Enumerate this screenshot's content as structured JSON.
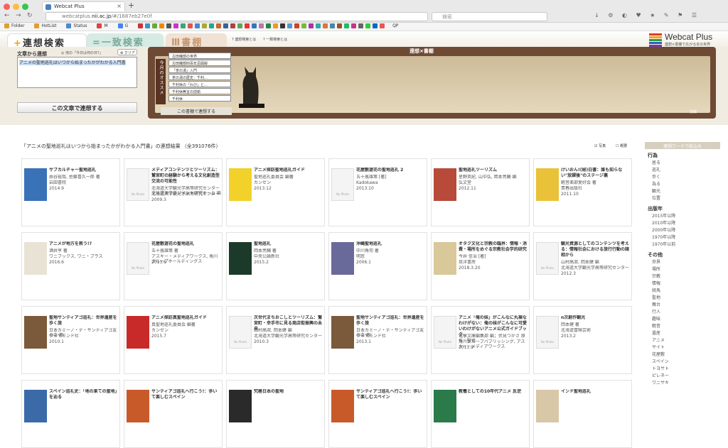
{
  "browser": {
    "tab_title": "Webcat Plus",
    "url_prefix": "webcatplus.",
    "url_domain": "nii.ac.jp",
    "url_suffix": "/#/1687eb27e0f",
    "search_placeholder": "検索"
  },
  "bookmarks": [
    "Folder",
    "HotList",
    "Status",
    "M",
    "G",
    "QP"
  ],
  "tabs": {
    "assoc": "連想検索",
    "exact": "一致検索",
    "shelf": "書棚"
  },
  "help": {
    "assoc": "連想検索とは",
    "exact": "一致検索とは"
  },
  "logo": {
    "title": "Webcat Plus",
    "sub": "連想×書棚で広がる本の世界",
    "colors": [
      "#e23a2a",
      "#f3a51c",
      "#2a9a4b",
      "#2a64b2",
      "#7a3aa0"
    ]
  },
  "query": {
    "label": "文章から連想",
    "sub": "他の「今日は何の日?」",
    "clear": "クリア",
    "text": "アニメの聖地巡礼はいつから始まったかがわかる入門書",
    "button": "この文章で連想する"
  },
  "shelf": {
    "title": "連想×書棚",
    "vertical": "今月のオススメ",
    "books": [
      "古田織部の世界",
      "古田織部四百年忌図録",
      "「茶の湯」入門",
      "茶の湯の歴史：千利…",
      "千利休の「わび」と…",
      "千利休無言の前衛",
      "千利休"
    ],
    "button": "この書棚で連想する",
    "bottom": "前編"
  },
  "results": {
    "summary": "「アニメの聖地巡礼はいつから始まったかがわかる入門書」の連想結果 （全391076件）",
    "photo": "写真",
    "abstract": "概要"
  },
  "nophoto": "No Photo",
  "cards": [
    {
      "title": "サブカルチャー聖地巡礼",
      "meta": [
        "由谷裕哉, 佐藤喜久一郎 著",
        "岩田書院",
        "2014.9"
      ],
      "thumb": "#3a72b8"
    },
    {
      "title": "メディアコンテンツとツーリズム：鷲宮町の経験から考える文化創造型交流の可能性",
      "meta": [
        "北海道大学観光学高等研究センター文化資源マネジメント研究チーム 編",
        "北海道大学観光学高等研究センター",
        "2009.3"
      ],
      "thumb": ""
    },
    {
      "title": "アニメ探訪聖地巡礼ガイド",
      "meta": [
        "聖地巡礼委員会 編著",
        "カンゼン",
        "2013.12"
      ],
      "thumb": "#f2d12a"
    },
    {
      "title": "花屋敷遊花の聖地巡礼 2",
      "meta": [
        "五十嵐雄策 [著]",
        "Kadokawa",
        "2013.10"
      ],
      "thumb": ""
    },
    {
      "title": "聖地巡礼ツーリズム",
      "meta": [
        "星野英紀, 山中弘, 岡本亮輔 編",
        "弘文堂",
        "2012.11"
      ],
      "thumb": "#b84a3a"
    },
    {
      "title": "けいおん!(秘)白書：誰も知らない\"放課後\"のステージ裏",
      "meta": [
        "軽音楽部愛好会 著",
        "青春出版社",
        "2011.10"
      ],
      "thumb": "#e9c23a"
    },
    {
      "title": "アニメが地方を救う!?",
      "meta": [
        "酒井亨 著",
        "ワニブックス, ワニ・プラス",
        "2016.6"
      ],
      "thumb": "#e8e3d4"
    },
    {
      "title": "花屋敷遊花の聖地巡礼",
      "meta": [
        "五十嵐雄策 著",
        "アスキー・メディアワークス, 角川グループホールディングス",
        "2013.6"
      ],
      "thumb": ""
    },
    {
      "title": "聖地巡礼",
      "meta": [
        "岡本亮輔 著",
        "中央公論新社",
        "2015.2"
      ],
      "thumb": "#1c3a2a"
    },
    {
      "title": "沖縄聖地巡礼",
      "meta": [
        "中川角司 著",
        "明窓",
        "2006.1"
      ],
      "thumb": "#6a6a9a"
    },
    {
      "title": "オタク文化と宗教の臨界：情報・消費・場所をめぐる宗教社会学的研究",
      "meta": [
        "今井 信治 [著]",
        "晃洋書房",
        "2018.3.20"
      ],
      "thumb": "#d8c89a"
    },
    {
      "title": "観光資源としてのコンテンツを考える：情報社会における旅行行動の諸相から",
      "meta": [
        "山村高淑, 岡本健 編",
        "北海道大学観光学高等研究センター",
        "2012.3"
      ],
      "thumb": ""
    },
    {
      "title": "聖地サンティアゴ巡礼：世界遺産を歩く旅",
      "meta": [
        "日本カミーノ・デ・サンティアゴ友の会 著",
        "ダイヤモンド社",
        "2010.1"
      ],
      "thumb": "#7a5a3a"
    },
    {
      "title": "アニメ探訪真聖地巡礼ガイド",
      "meta": [
        "真聖地巡礼委員会 編著",
        "カンゼン",
        "2015.7"
      ],
      "thumb": "#c82a2a"
    },
    {
      "title": "次世代まちおこしとツーリズム：鷲宮町・幸手市に見る商店街振興の未来",
      "meta": [
        "山村高淑, 岡本健 編",
        "北海道大学観光学高等研究センター",
        "2010.3"
      ],
      "thumb": ""
    },
    {
      "title": "聖地サンティアゴ巡礼：世界遺産を歩く旅",
      "meta": [
        "日本カミーノ・デ・サンティアゴ友の会 著",
        "ダイヤモンド社",
        "2013.1"
      ],
      "thumb": "#7a5a3a"
    },
    {
      "title": "アニメ「俺の妹」がこんなに丸裸なわけがない：俺の妹がこんなに可愛いわけがないアニメ公式ガイドブック",
      "meta": [
        "電撃文庫編集部 編；伏見つかさ 原作・監修",
        "角川グループパブリッシング, アスキー・メディアワークス",
        "2011.9"
      ],
      "thumb": ""
    },
    {
      "title": "n次創作観光",
      "meta": [
        "岡本健 著",
        "北海道冒険芸術",
        "2013.2"
      ],
      "thumb": ""
    },
    {
      "title": "スペイン巡礼史：「地の果ての聖地」を辿る",
      "meta": [],
      "thumb": "#3a6aa8"
    },
    {
      "title": "サンティアゴ巡礼へ行こう!：歩いて楽しむスペイン",
      "meta": [],
      "thumb": "#c85a2a"
    },
    {
      "title": "究極日本の聖地",
      "meta": [],
      "thumb": "#2a2a2a"
    },
    {
      "title": "サンティアゴ巡礼へ行こう!：歩いて楽しむスペイン",
      "meta": [],
      "thumb": "#c85a2a"
    },
    {
      "title": "教養としての10年代アニメ 反逆",
      "meta": [],
      "thumb": "#2a7a4a"
    },
    {
      "title": "インド聖地巡礼",
      "meta": [],
      "thumb": "#d8c8a8"
    }
  ],
  "sidebar": {
    "header": "連想ワードで絞込み",
    "sections": [
      {
        "title": "行為",
        "items": [
          "居る",
          "巡礼",
          "歩く",
          "為る",
          "観光",
          "位置"
        ]
      },
      {
        "title": "出版年",
        "items": [
          "2015年以降",
          "2010年以降",
          "2000年以降",
          "1970年以降",
          "1970年以前"
        ]
      },
      {
        "title": "その他",
        "items": [
          "世界",
          "場所",
          "宗教",
          "情報",
          "続馬",
          "聖地",
          "舞台",
          "行人",
          "趣味",
          "軽音",
          "遺産",
          "アニメ",
          "サイト",
          "花屋敷",
          "スペイン",
          "トヨサト",
          "ピレネー",
          "ワニサキ"
        ]
      }
    ]
  }
}
